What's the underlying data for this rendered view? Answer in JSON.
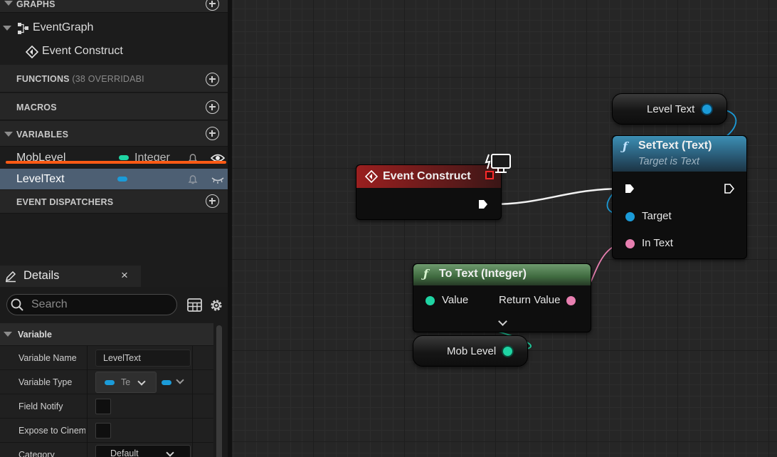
{
  "sidebar": {
    "graphs_header": "GRAPHS",
    "event_graph": "EventGraph",
    "event_construct": "Event Construct",
    "functions_header": "FUNCTIONS",
    "functions_sub": "(38 OVERRIDABI",
    "macros_header": "MACROS",
    "variables_header": "VARIABLES",
    "variables": [
      {
        "name": "MobLevel",
        "type": "Integer",
        "pill_color": "#1fd4a3"
      },
      {
        "name": "LevelText",
        "type": "",
        "pill_color": "#1b9bd8"
      }
    ],
    "event_dispatchers_header": "EVENT DISPATCHERS"
  },
  "details": {
    "tab_label": "Details",
    "search_placeholder": "Search",
    "section": "Variable",
    "rows": [
      {
        "label": "Variable Name",
        "value": "LevelText"
      },
      {
        "label": "Variable Type",
        "value": "Te"
      },
      {
        "label": "Field Notify",
        "value": ""
      },
      {
        "label": "Expose to Cinematics",
        "value": ""
      },
      {
        "label": "Category",
        "value": "Default"
      }
    ]
  },
  "graph": {
    "event_construct": {
      "title": "Event Construct"
    },
    "set_text": {
      "title": "SetText (Text)",
      "subtitle": "Target is Text",
      "pin_target": "Target",
      "pin_in_text": "In Text"
    },
    "level_text_var": {
      "label": "Level Text"
    },
    "to_text": {
      "title": "To Text (Integer)",
      "pin_value": "Value",
      "pin_return": "Return Value"
    },
    "mob_level_var": {
      "label": "Mob Level"
    }
  },
  "colors": {
    "integer_pin": "#1fd4a3",
    "object_pin": "#1b9bd8",
    "text_pin": "#e77fb0",
    "event_head": "#8a1c1c",
    "function_head": "#2f6a86",
    "pure_function_head": "#4b7a4b",
    "highlight_underline": "#ff5a14"
  }
}
